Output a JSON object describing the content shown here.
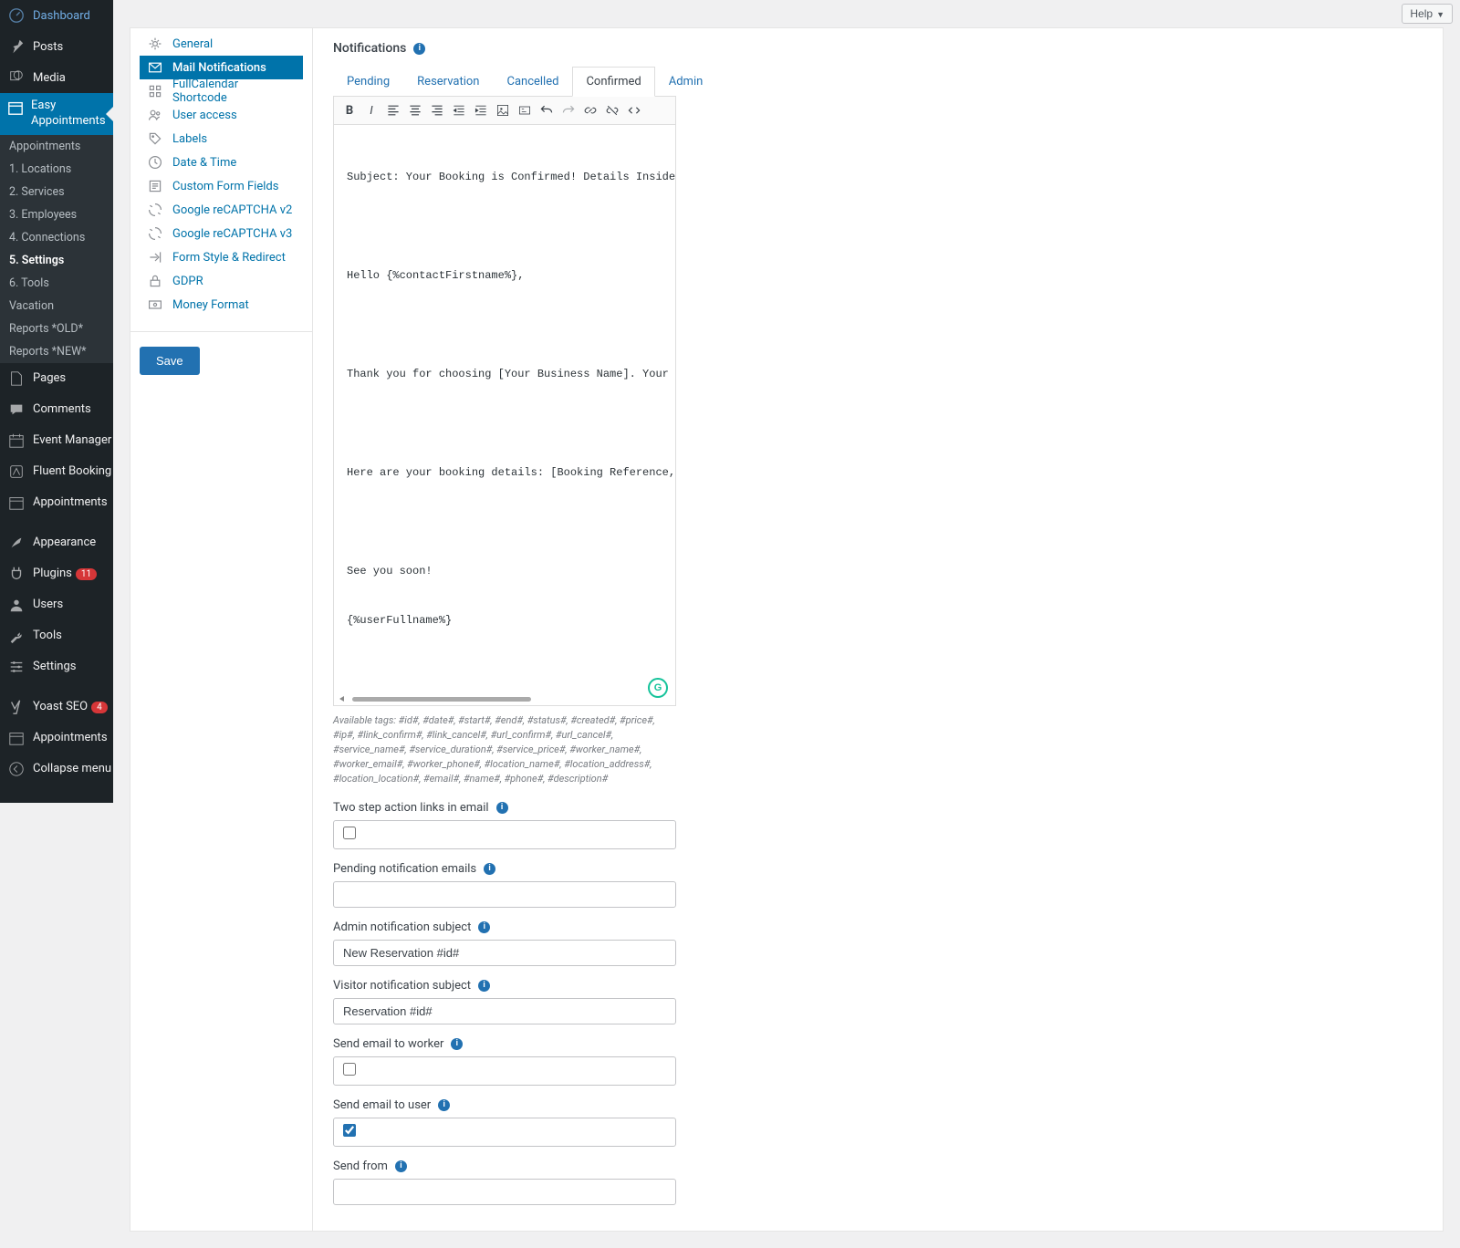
{
  "topbar": {
    "help": "Help"
  },
  "adminMenu": {
    "dashboard": "Dashboard",
    "posts": "Posts",
    "media": "Media",
    "easyAppt": "Easy Appointments",
    "sub": {
      "appointments": "Appointments",
      "locations": "1. Locations",
      "services": "2. Services",
      "employees": "3. Employees",
      "connections": "4. Connections",
      "settings": "5. Settings",
      "tools": "6. Tools",
      "vacation": "Vacation",
      "reportsOld": "Reports *OLD*",
      "reportsNew": "Reports *NEW*"
    },
    "pages": "Pages",
    "comments": "Comments",
    "eventManager": "Event Manager",
    "fluentBooking": "Fluent Booking",
    "appointments2": "Appointments",
    "appearance": "Appearance",
    "plugins": "Plugins",
    "pluginsBadge": "11",
    "users": "Users",
    "tools": "Tools",
    "settings": "Settings",
    "yoast": "Yoast SEO",
    "yoastBadge": "4",
    "appointments3": "Appointments",
    "collapse": "Collapse menu"
  },
  "settingsNav": {
    "general": "General",
    "mail": "Mail Notifications",
    "fullcal": "FullCalendar Shortcode",
    "userAccess": "User access",
    "labels": "Labels",
    "dateTime": "Date & Time",
    "customForm": "Custom Form Fields",
    "recap2": "Google reCAPTCHA v2",
    "recap3": "Google reCAPTCHA v3",
    "formStyle": "Form Style & Redirect",
    "gdpr": "GDPR",
    "money": "Money Format",
    "save": "Save"
  },
  "notifications": {
    "title": "Notifications",
    "tabs": {
      "pending": "Pending",
      "reservation": "Reservation",
      "cancelled": "Cancelled",
      "confirmed": "Confirmed",
      "admin": "Admin"
    },
    "editorLines": [
      "Subject: Your Booking is Confirmed! Details Inside.",
      "",
      "Hello {%contactFirstname%},",
      "",
      "Thank you for choosing [Your Business Name]. Your booking for [s",
      "",
      "Here are your booking details: [Booking Reference, Details].",
      "",
      "See you soon!",
      "{%userFullname%}"
    ],
    "tags": "Available tags: #id#, #date#, #start#, #end#, #status#, #created#, #price#, #ip#, #link_confirm#, #link_cancel#, #url_confirm#, #url_cancel#, #service_name#, #service_duration#, #service_price#, #worker_name#, #worker_email#, #worker_phone#, #location_name#, #location_address#, #location_location#, #email#, #name#, #phone#, #description#",
    "fields": {
      "twoStep": "Two step action links in email",
      "pendingEmails": "Pending notification emails",
      "adminSubject": "Admin notification subject",
      "adminSubjectValue": "New Reservation #id#",
      "visitorSubject": "Visitor notification subject",
      "visitorSubjectValue": "Reservation #id#",
      "sendWorker": "Send email to worker",
      "sendUser": "Send email to user",
      "sendFrom": "Send from"
    }
  }
}
